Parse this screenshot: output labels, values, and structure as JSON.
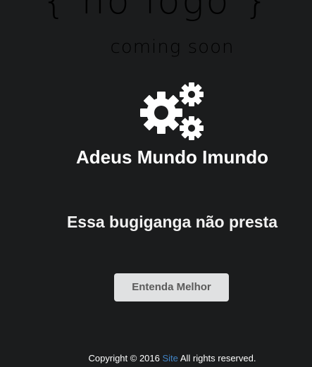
{
  "logo": {
    "text": "{ no logo }"
  },
  "coming_soon": {
    "text": "coming soon"
  },
  "icons": {
    "gears": "gears-icon"
  },
  "heading": {
    "title": "Adeus Mundo Imundo"
  },
  "message": {
    "subtitle": "Essa bugiganga não presta"
  },
  "cta": {
    "label": "Entenda Melhor"
  },
  "footer": {
    "prefix": "Copyright © 2016",
    "link_label": "Site",
    "suffix": "All rights reserved."
  },
  "colors": {
    "background": "#1b1c1d",
    "button_bg": "#e0e1e2",
    "button_text": "#5b5b5b",
    "link": "#4183c4"
  }
}
